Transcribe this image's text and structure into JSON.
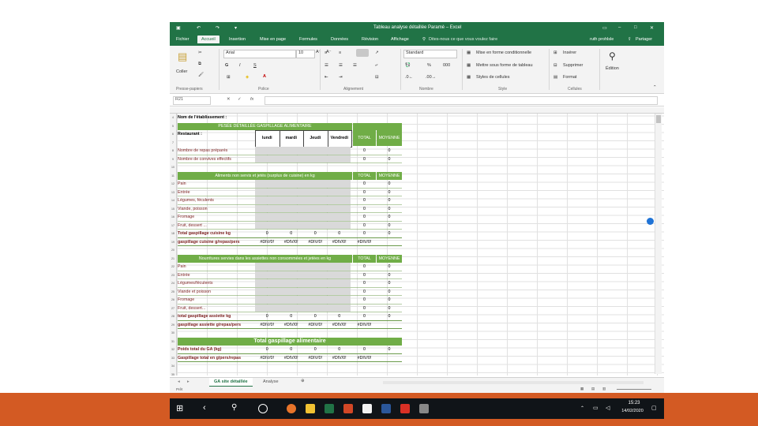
{
  "window": {
    "title": "Tableau analyse détaillée Paramè – Excel",
    "user": "ruth prohlsle",
    "share": "Partager",
    "search_hint": "Dites-nous ce que vous voulez faire"
  },
  "ribbon_tabs": [
    "Fichier",
    "Accueil",
    "Insertion",
    "Mise en page",
    "Formules",
    "Données",
    "Révision",
    "Affichage"
  ],
  "ribbon": {
    "paste": "Coller",
    "font_name": "Arial",
    "font_size": "10",
    "bold": "G",
    "italic": "I",
    "underline": "S",
    "number_format": "Standard",
    "cond_format": "Mise en forme conditionnelle",
    "table_format": "Mettre sous forme de tableau",
    "cell_styles": "Styles de cellules",
    "insert": "Insérer",
    "delete": "Supprimer",
    "format": "Format",
    "edit": "Édition",
    "groups": [
      "Presse-papiers",
      "Police",
      "Alignement",
      "Nombre",
      "Style",
      "Cellules"
    ]
  },
  "formula_bar": {
    "name_box": "R21",
    "fx": "fx"
  },
  "row_numbers": [
    "4",
    "5",
    "6",
    "7",
    "8",
    "9",
    "10",
    "11",
    "12",
    "13",
    "14",
    "15",
    "16",
    "17",
    "18",
    "19",
    "20",
    "21",
    "22",
    "23",
    "24",
    "25",
    "26",
    "27",
    "28",
    "29",
    "30",
    "31",
    "32",
    "33",
    "34",
    "35"
  ],
  "sheet": {
    "establishment": "Nom de l'établissement :",
    "section1_title": "PESÉE DÉTAILLÉE GASPILLAGE ALIMENTAIRE",
    "restaurant": "Restaurant :",
    "days": [
      "lundi",
      "mardi",
      "Jeudi",
      "Vendredi"
    ],
    "total": "TOTAL",
    "moyenne": "MOYENNE",
    "meals_prepared": "Nombre de repas préparés",
    "guests": "Nombre de convives effectifs",
    "section2_title": "Aliments non servis et jetés (surplus de cuisine) en kg",
    "section2_rows": [
      "Pain",
      "Entrée",
      "Légumes, féculents",
      "Viande, poisson",
      "Fromage",
      "Fruit, dessert ..."
    ],
    "kitchen_total": "Total gaspillage cuisine kg",
    "kitchen_per_meal": "gaspillage cuisine g/repas/pers",
    "section3_title": "Nourritures servies dans les assiettes non consommées et jetées en kg",
    "section3_rows": [
      "Pain",
      "Entrée",
      "Légumes/féculents",
      "Viande et poisson",
      "Fromage",
      "Fruit, dessert..."
    ],
    "plate_total": "total gaspillage assiette kg",
    "plate_per_meal": "gaspillage assiette g/repas/pers",
    "section4_title": "Total gaspillage alimentaire",
    "total_weight": "Poids total du GA (kg)",
    "total_per_meal": "Gaspillage total en g/pers/repas",
    "zero": "0",
    "div0": "#DIV/0!"
  },
  "sheet_tabs": [
    "GA site détaillée",
    "Analyse"
  ],
  "status": {
    "left": "Prêt"
  },
  "taskbar": {
    "time": "15:23",
    "date": "14/02/2020"
  },
  "colors": {
    "excel_green": "#217346",
    "header_green": "#70ad47",
    "accent_orange": "#d35a23"
  }
}
